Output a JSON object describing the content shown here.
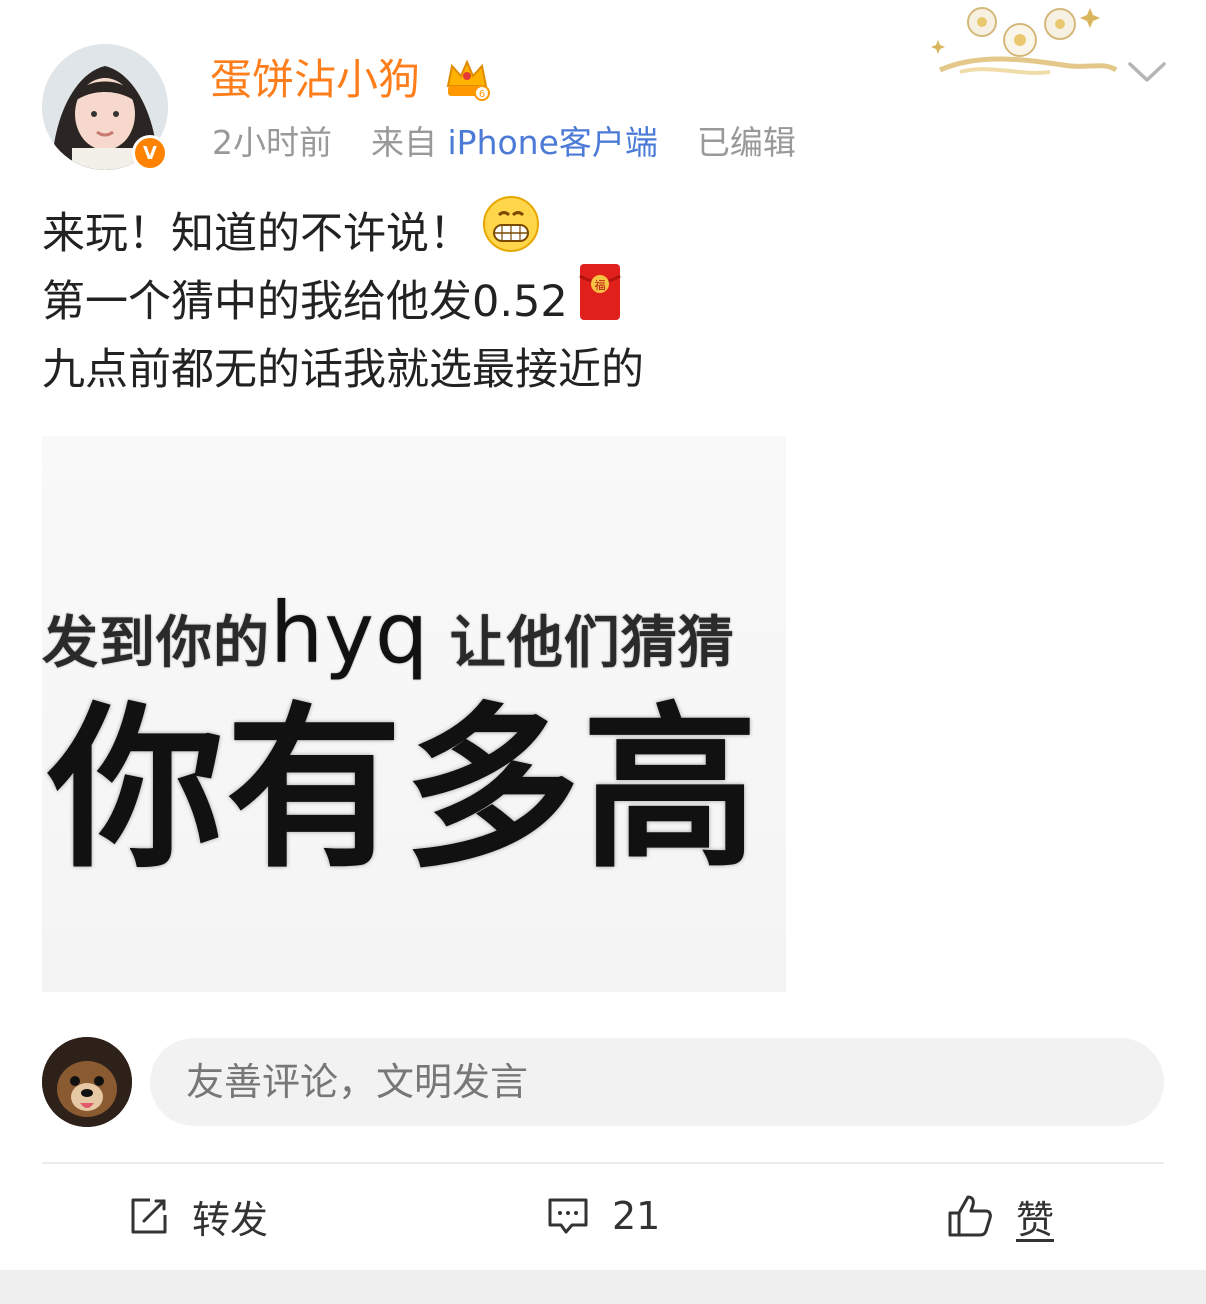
{
  "post": {
    "author": {
      "name": "蛋饼沾小狗",
      "verified_mark": "V"
    },
    "meta": {
      "time": "2小时前",
      "source_prefix": "来自",
      "source_device": "iPhone客户端",
      "edited": "已编辑"
    },
    "text_lines": [
      "来玩！知道的不许说！",
      "第一个猜中的我给他发0.52",
      "九点前都无的话我就选最接近的"
    ],
    "inline_emojis": [
      "grinning-face",
      "red-envelope"
    ],
    "image": {
      "line1_a": "发到你的",
      "line1_hyq": "hyq",
      "line1_b": " 让他们猜猜",
      "line2": "你有多高",
      "red_envelope_char": "福"
    }
  },
  "composer": {
    "placeholder": "友善评论，文明发言"
  },
  "actions": {
    "repost_label": "转发",
    "comment_count": "21",
    "like_label": "赞"
  },
  "colors": {
    "username": "#ff7e1c",
    "verified_badge": "#ff8200",
    "device_link": "#4b7bd6",
    "meta_gray": "#999999",
    "input_bg": "#f2f2f2"
  }
}
